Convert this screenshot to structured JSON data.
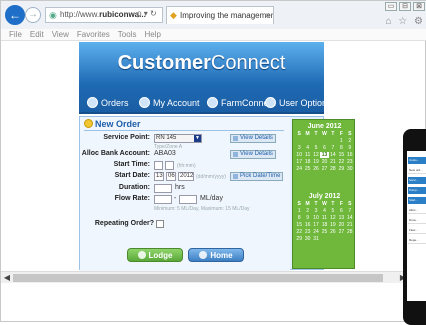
{
  "browser": {
    "url_prefix": "http://www.",
    "url_host": "rubiconwa...",
    "address_tools": "ρ ▾ ↻",
    "tab_title": "Improving the managemen...",
    "tab_close": "×",
    "menu": [
      "File",
      "Edit",
      "View",
      "Favorites",
      "Tools",
      "Help"
    ],
    "window_controls": [
      "▭",
      "⊟",
      "⊠"
    ],
    "toolbar_icons": "⌂ ☆ ⚙"
  },
  "site": {
    "logo_bold": "Customer",
    "logo_light": "Connect",
    "nav": [
      "Orders",
      "My Account",
      "FarmConnect",
      "User Options"
    ]
  },
  "form": {
    "title": "New Order",
    "service_point_label": "Service Point:",
    "service_point_value": "RN 145",
    "service_point_type": "Type/Zone A",
    "view_details": "View Details",
    "alloc_label": "Alloc Bank Account:",
    "alloc_value": "ABA03",
    "start_time_label": "Start Time:",
    "start_time_hint": "(hh:mm)",
    "start_date_label": "Start Date:",
    "start_date_d": "13",
    "start_date_m": "06",
    "start_date_y": "2012",
    "start_date_hint": "(dd/mm/yyyy)",
    "pick_date": "Pick Date/Time",
    "duration_label": "Duration:",
    "duration_unit": "hrs",
    "flow_rate_label": "Flow Rate:",
    "flow_rate_unit": "ML/day",
    "flow_rate_sep": "-",
    "flow_rate_hint": "Minimum: 5 ML/Day, Maximum: 15 ML/Day",
    "repeating_label": "Repeating Order?",
    "lodge": "Lodge",
    "home": "Home"
  },
  "calendars": [
    {
      "title": "June 2012",
      "headers": [
        "S",
        "M",
        "T",
        "W",
        "T",
        "F",
        "S"
      ],
      "days": [
        "",
        "",
        "",
        "",
        "",
        "1",
        "2",
        "3",
        "4",
        "5",
        "6",
        "7",
        "8",
        "9",
        "10",
        "11",
        "12",
        "13",
        "14",
        "15",
        "16",
        "17",
        "18",
        "19",
        "20",
        "21",
        "22",
        "23",
        "24",
        "25",
        "26",
        "27",
        "28",
        "29",
        "30"
      ],
      "today": "13"
    },
    {
      "title": "July 2012",
      "headers": [
        "S",
        "M",
        "T",
        "W",
        "T",
        "F",
        "S"
      ],
      "days": [
        "1",
        "2",
        "3",
        "4",
        "5",
        "6",
        "7",
        "8",
        "9",
        "10",
        "11",
        "12",
        "13",
        "14",
        "15",
        "16",
        "17",
        "18",
        "19",
        "20",
        "21",
        "22",
        "23",
        "24",
        "25",
        "26",
        "27",
        "28",
        "29",
        "30",
        "31"
      ],
      "today": ""
    }
  ],
  "phone": {
    "rows": [
      "Custo...",
      "New ord...",
      "Servi...",
      "Pump...",
      "Start...",
      "Alloc...",
      "Dura...",
      "Flow...",
      "Repe..."
    ]
  },
  "colors": {
    "header_blue": "#2a7fc6",
    "calendar_green": "#6fb83c",
    "lodge_green": "#5aa83a"
  }
}
